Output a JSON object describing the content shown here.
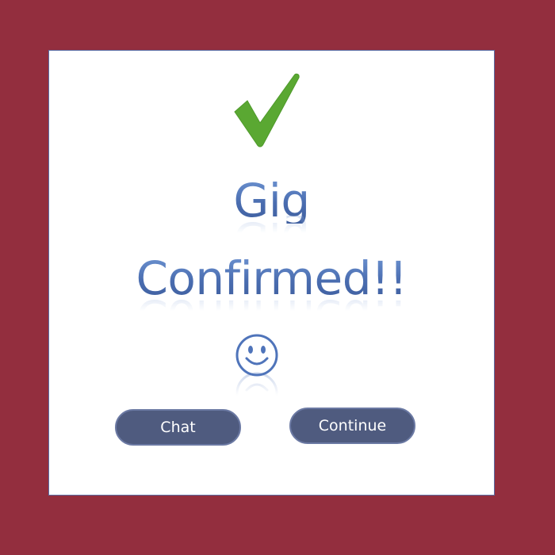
{
  "dialog": {
    "title_line1": "Gig",
    "title_line2": "Confirmed!!",
    "check_icon": "check-icon",
    "smiley_icon": "smiley-icon"
  },
  "buttons": {
    "chat_label": "Chat",
    "continue_label": "Continue"
  },
  "colors": {
    "background": "#932e3e",
    "dialog_bg": "#ffffff",
    "title_blue": "#4f74ba",
    "check_green": "#5aa832",
    "button_bg": "#4f5b7f"
  }
}
